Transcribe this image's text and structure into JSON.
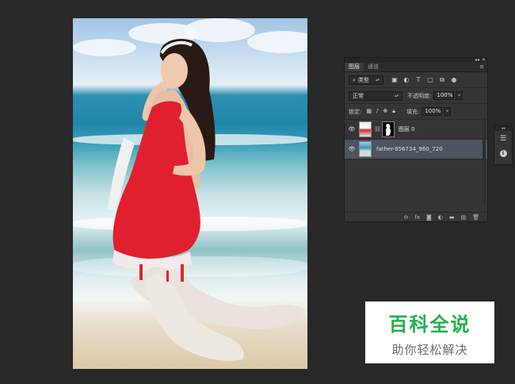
{
  "layers_panel": {
    "tabs": [
      "图层",
      "通道"
    ],
    "filter": {
      "kind_label": "类型"
    },
    "blend_mode": "正常",
    "opacity": {
      "label": "不透明度:",
      "value": "100%"
    },
    "lock": {
      "label": "锁定:"
    },
    "fill": {
      "label": "填充:",
      "value": "100%"
    },
    "layers": [
      {
        "name": "图层 0",
        "selected": false
      },
      {
        "name": "father-656734_960_720",
        "selected": true
      }
    ],
    "footer_icons": [
      "link-icon",
      "fx-icon",
      "mask-icon",
      "adjustment-icon",
      "group-icon",
      "new-layer-icon",
      "trash-icon"
    ]
  },
  "watermark": {
    "logo_text": "百科全说",
    "tagline": "助你轻松解决",
    "brand_color": "#22b14c"
  },
  "colors": {
    "workspace_bg": "#282828",
    "panel_bg": "#353535",
    "selected_row": "#4c5361"
  }
}
